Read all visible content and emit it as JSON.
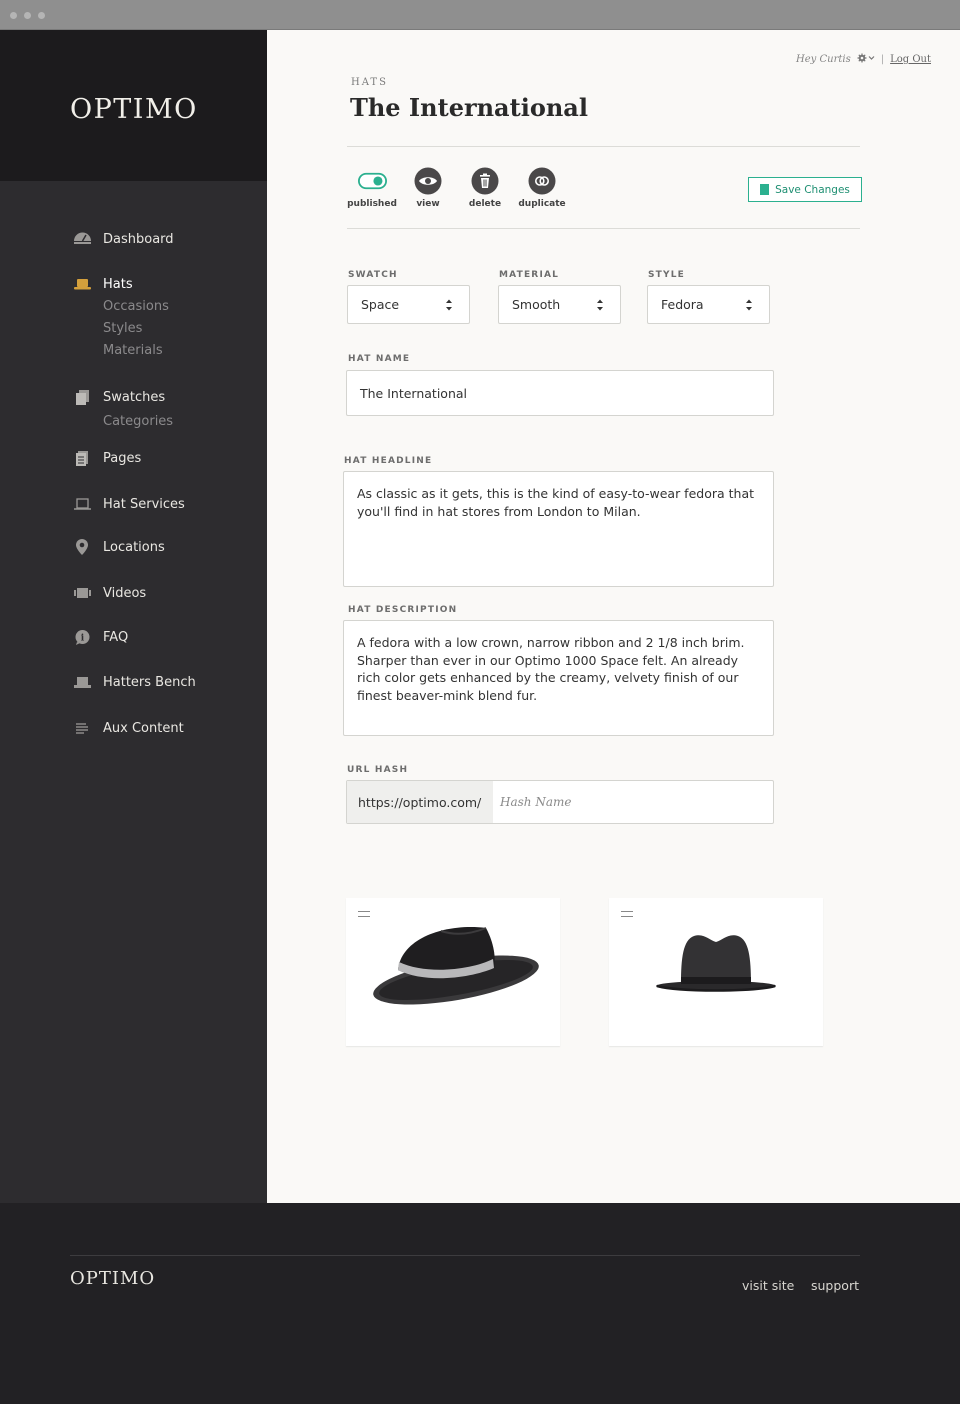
{
  "brand": {
    "name": "OPTIMO"
  },
  "user": {
    "greeting": "Hey Curtis",
    "logout": "Log Out"
  },
  "sidebar": {
    "items": [
      {
        "label": "Dashboard",
        "icon": "dashboard-icon"
      },
      {
        "label": "Hats",
        "icon": "hat-icon",
        "active": true,
        "sub": [
          "Occasions",
          "Styles",
          "Materials"
        ]
      },
      {
        "label": "Swatches",
        "icon": "swatches-icon",
        "sub": [
          "Categories"
        ]
      },
      {
        "label": "Pages",
        "icon": "pages-icon"
      },
      {
        "label": "Hat Services",
        "icon": "hat-services-icon"
      },
      {
        "label": "Locations",
        "icon": "location-pin-icon"
      },
      {
        "label": "Videos",
        "icon": "video-icon"
      },
      {
        "label": "FAQ",
        "icon": "faq-icon"
      },
      {
        "label": "Hatters Bench",
        "icon": "bench-icon"
      },
      {
        "label": "Aux Content",
        "icon": "lines-icon"
      }
    ]
  },
  "page": {
    "breadcrumb": "HATS",
    "title": "The International"
  },
  "actions": {
    "published": "published",
    "view": "view",
    "delete": "delete",
    "duplicate": "duplicate",
    "save": "Save Changes"
  },
  "form": {
    "swatch": {
      "label": "SWATCH",
      "value": "Space"
    },
    "material": {
      "label": "MATERIAL",
      "value": "Smooth"
    },
    "style": {
      "label": "STYLE",
      "value": "Fedora"
    },
    "hat_name": {
      "label": "HAT NAME",
      "value": "The International"
    },
    "headline": {
      "label": "HAT HEADLINE",
      "value": "As classic as it gets, this is the kind of easy-to-wear fedora that you'll find in hat stores from London to Milan."
    },
    "description": {
      "label": "HAT DESCRIPTION",
      "value": "A fedora with a low crown, narrow ribbon and 2 1/8 inch brim. Sharper than ever in our Optimo 1000 Space felt. An already rich color gets enhanced by the creamy, velvety finish of our finest beaver-mink blend fur."
    },
    "url": {
      "label": "URL HASH",
      "prefix": "https://optimo.com/",
      "placeholder": "Hash Name"
    }
  },
  "colors": {
    "accent": "#2bb08f",
    "sidebar_icon": "#c99a3c"
  },
  "footer": {
    "logo": "OPTIMO",
    "links": [
      "visit site",
      "support"
    ]
  }
}
